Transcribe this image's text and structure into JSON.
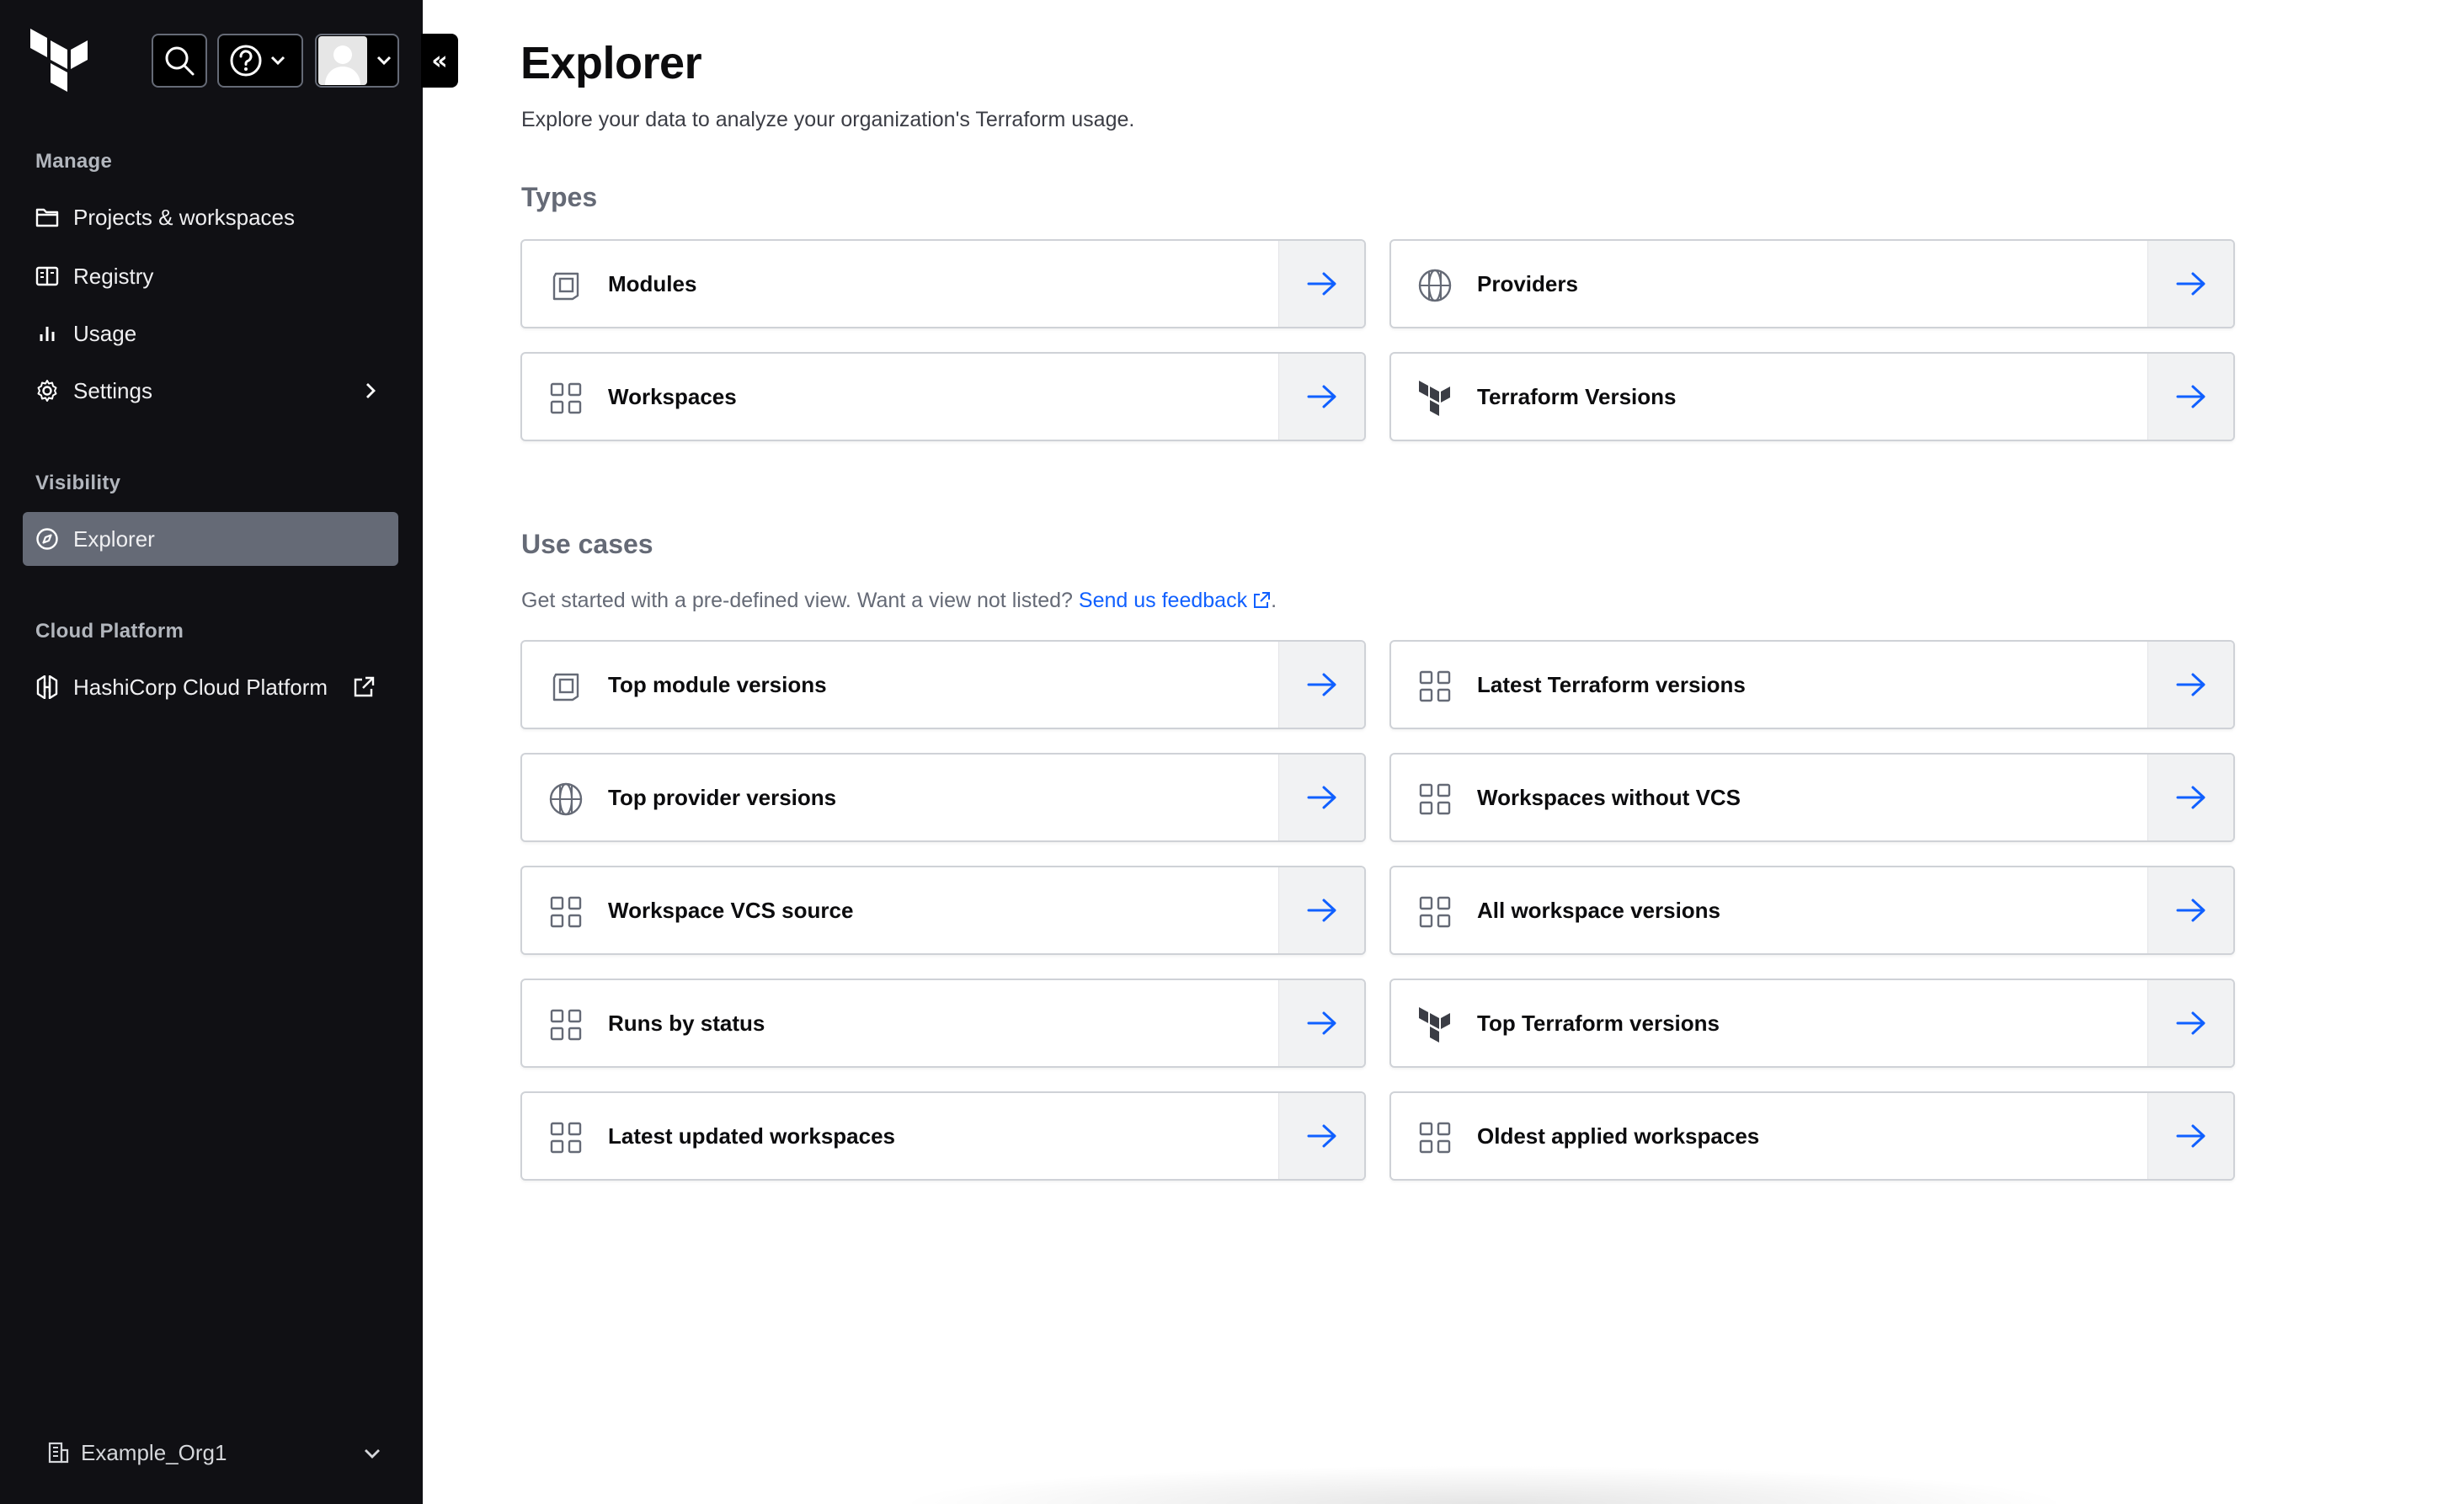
{
  "sidebar": {
    "sections": {
      "manage": "Manage",
      "visibility": "Visibility",
      "cloud_platform": "Cloud Platform"
    },
    "items": {
      "projects": "Projects & workspaces",
      "registry": "Registry",
      "usage": "Usage",
      "settings": "Settings",
      "explorer": "Explorer",
      "hcp": "HashiCorp Cloud Platform"
    },
    "collapse_label": "«",
    "org": "Example_Org1"
  },
  "main": {
    "title": "Explorer",
    "subtitle": "Explore your data to analyze your organization's Terraform usage.",
    "types_heading": "Types",
    "types": [
      {
        "label": "Modules",
        "icon": "module-icon"
      },
      {
        "label": "Providers",
        "icon": "globe-icon"
      },
      {
        "label": "Workspaces",
        "icon": "grid-icon"
      },
      {
        "label": "Terraform Versions",
        "icon": "terraform-icon"
      }
    ],
    "usecases_heading": "Use cases",
    "usecases_desc": "Get started with a pre-defined view. Want a view not listed?",
    "feedback_link": "Send us feedback",
    "feedback_period": ".",
    "usecases": [
      {
        "label": "Top module versions",
        "icon": "module-icon"
      },
      {
        "label": "Latest Terraform versions",
        "icon": "grid-icon"
      },
      {
        "label": "Top provider versions",
        "icon": "globe-icon"
      },
      {
        "label": "Workspaces without VCS",
        "icon": "grid-icon"
      },
      {
        "label": "Workspace VCS source",
        "icon": "grid-icon"
      },
      {
        "label": "All workspace versions",
        "icon": "grid-icon"
      },
      {
        "label": "Runs by status",
        "icon": "grid-icon"
      },
      {
        "label": "Top Terraform versions",
        "icon": "terraform-icon"
      },
      {
        "label": "Latest updated workspaces",
        "icon": "grid-icon"
      },
      {
        "label": "Oldest applied workspaces",
        "icon": "grid-icon"
      }
    ]
  },
  "colors": {
    "sidebar_bg": "#101014",
    "active_bg": "#656a76",
    "link": "#1060ff",
    "arrow": "#1060ff"
  }
}
